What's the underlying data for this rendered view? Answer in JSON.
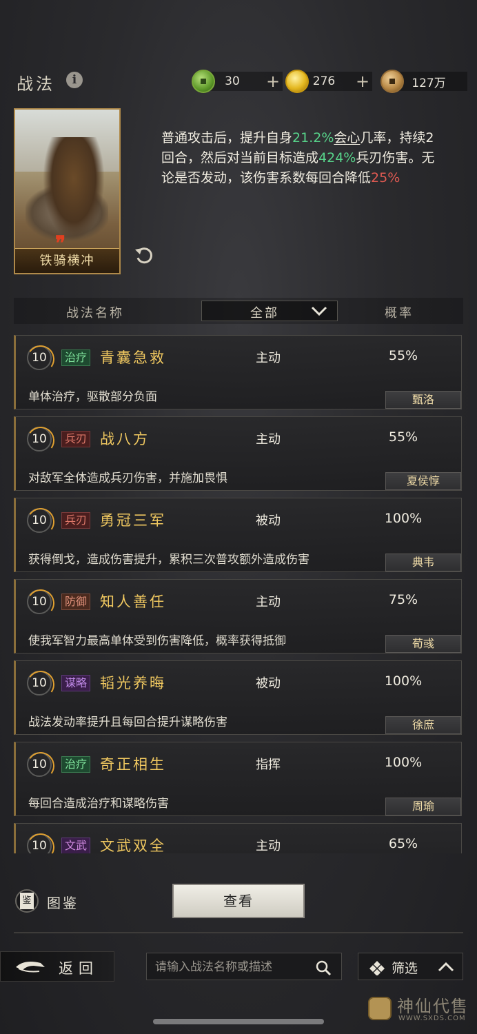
{
  "header": {
    "title": "战法",
    "currencies": [
      {
        "icon": "jade-coin-icon",
        "value": "30",
        "has_plus": true
      },
      {
        "icon": "gold-coin-icon",
        "value": "276",
        "has_plus": true
      },
      {
        "icon": "copper-coin-icon",
        "value": "127万",
        "has_plus": false
      }
    ]
  },
  "selected_skill": {
    "card_name": "铁骑横冲",
    "description": {
      "p1": "普通攻击后，提升自身",
      "v1": "21.2%",
      "k1": "会心",
      "p2": "几率，持续2回合，然后对当前目标造成",
      "v2": "424%",
      "p3": "兵刃伤害。无论是否发动，该伤害系数每回合降低",
      "v3": "25%"
    }
  },
  "table_header": {
    "name_col": "战法名称",
    "filter_value": "全部",
    "rate_col": "概率"
  },
  "skills": [
    {
      "level": "10",
      "tag": "治疗",
      "name": "青囊急救",
      "type": "主动",
      "rate": "55%",
      "desc": "单体治疗，驱散部分负面",
      "owner": "甄洛"
    },
    {
      "level": "10",
      "tag": "兵刃",
      "name": "战八方",
      "type": "主动",
      "rate": "55%",
      "desc": "对敌军全体造成兵刃伤害，并施加畏惧",
      "owner": "夏侯惇"
    },
    {
      "level": "10",
      "tag": "兵刃",
      "name": "勇冠三军",
      "type": "被动",
      "rate": "100%",
      "desc": "获得倒戈，造成伤害提升，累积三次普攻额外造成伤害",
      "owner": "典韦"
    },
    {
      "level": "10",
      "tag": "防御",
      "name": "知人善任",
      "type": "主动",
      "rate": "75%",
      "desc": "使我军智力最高单体受到伤害降低，概率获得抵御",
      "owner": "荀彧"
    },
    {
      "level": "10",
      "tag": "谋略",
      "name": "韬光养晦",
      "type": "被动",
      "rate": "100%",
      "desc": "战法发动率提升且每回合提升谋略伤害",
      "owner": "徐庶"
    },
    {
      "level": "10",
      "tag": "治疗",
      "name": "奇正相生",
      "type": "指挥",
      "rate": "100%",
      "desc": "每回合造成治疗和谋略伤害",
      "owner": "周瑜"
    },
    {
      "level": "10",
      "tag": "文武",
      "name": "文武双全",
      "type": "主动",
      "rate": "65%",
      "desc": "",
      "owner": ""
    }
  ],
  "bottom": {
    "book_label": "图鉴",
    "view_button": "查看",
    "back_label": "返回",
    "search_placeholder": "请输入战法名称或描述",
    "filter_label": "筛选"
  },
  "watermark": {
    "brand": "神仙代售",
    "url": "WWW.SXDS.COM"
  }
}
